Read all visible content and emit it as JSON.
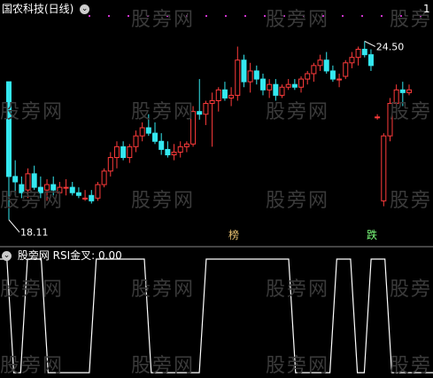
{
  "main_panel": {
    "title": "国农科技(日线)",
    "high_label": "24.50",
    "low_label": "18.11",
    "tag_left": "榜",
    "tag_right": "跌",
    "right_corner": "1"
  },
  "sub_panel": {
    "title": "股旁网 RSI金叉: 0.00"
  },
  "watermark": "股旁网",
  "colors": {
    "up": "#ff3b3b",
    "down": "#34e8f0",
    "dot": "#cc33cc",
    "tag_left": "#e8c070",
    "tag_right": "#7cff7c",
    "line": "#ffffff"
  },
  "chart_data": [
    {
      "type": "candlestick",
      "title": "国农科技(日线)",
      "ylim": [
        17.5,
        25.5
      ],
      "annotations": [
        {
          "text": "24.50",
          "note": "period high"
        },
        {
          "text": "18.11",
          "note": "period low"
        }
      ],
      "candles": [
        [
          23.2,
          23.2,
          18.1,
          19.7
        ],
        [
          19.7,
          20.3,
          19.0,
          19.5
        ],
        [
          19.4,
          19.7,
          18.9,
          19.1
        ],
        [
          19.2,
          20.0,
          18.9,
          19.8
        ],
        [
          19.8,
          20.1,
          19.2,
          19.3
        ],
        [
          19.3,
          19.7,
          18.9,
          19.1
        ],
        [
          19.2,
          19.6,
          18.8,
          19.4
        ],
        [
          19.4,
          19.7,
          19.0,
          19.2
        ],
        [
          19.1,
          19.5,
          18.9,
          19.3
        ],
        [
          19.3,
          19.6,
          19.0,
          19.3
        ],
        [
          19.3,
          19.5,
          19.0,
          19.1
        ],
        [
          19.1,
          19.3,
          18.9,
          19.0
        ],
        [
          18.9,
          19.2,
          18.8,
          18.9
        ],
        [
          19.0,
          19.2,
          18.7,
          18.8
        ],
        [
          18.9,
          19.5,
          18.8,
          19.4
        ],
        [
          19.4,
          20.0,
          19.3,
          19.9
        ],
        [
          19.9,
          20.6,
          19.7,
          20.4
        ],
        [
          20.4,
          21.0,
          20.0,
          20.8
        ],
        [
          20.8,
          21.0,
          20.3,
          20.4
        ],
        [
          20.4,
          20.9,
          20.2,
          20.8
        ],
        [
          20.8,
          21.4,
          20.6,
          21.2
        ],
        [
          21.2,
          21.7,
          21.0,
          21.5
        ],
        [
          21.5,
          22.0,
          21.2,
          21.3
        ],
        [
          21.3,
          21.7,
          20.9,
          21.0
        ],
        [
          21.0,
          21.3,
          20.5,
          20.7
        ],
        [
          20.7,
          21.0,
          20.4,
          20.5
        ],
        [
          20.5,
          20.9,
          20.3,
          20.6
        ],
        [
          20.6,
          21.0,
          20.4,
          20.8
        ],
        [
          20.8,
          21.0,
          20.6,
          20.9
        ],
        [
          20.9,
          22.3,
          20.8,
          22.1
        ],
        [
          22.1,
          23.3,
          21.8,
          22.0
        ],
        [
          22.0,
          22.5,
          21.6,
          22.4
        ],
        [
          22.4,
          22.8,
          20.8,
          22.5
        ],
        [
          22.5,
          23.0,
          22.1,
          22.9
        ],
        [
          22.9,
          23.2,
          22.5,
          22.6
        ],
        [
          22.6,
          23.0,
          22.3,
          22.7
        ],
        [
          22.7,
          24.5,
          22.5,
          24.0
        ],
        [
          24.0,
          24.2,
          23.0,
          23.2
        ],
        [
          23.2,
          23.9,
          22.8,
          23.6
        ],
        [
          23.6,
          23.8,
          23.1,
          23.3
        ],
        [
          23.3,
          23.5,
          22.7,
          22.9
        ],
        [
          22.9,
          23.3,
          22.6,
          23.1
        ],
        [
          23.1,
          23.3,
          22.5,
          22.7
        ],
        [
          22.7,
          23.1,
          22.6,
          23.0
        ],
        [
          23.0,
          23.3,
          22.9,
          23.1
        ],
        [
          23.1,
          23.3,
          22.9,
          23.0
        ],
        [
          23.0,
          23.4,
          22.8,
          23.3
        ],
        [
          23.3,
          23.6,
          23.1,
          23.5
        ],
        [
          23.5,
          23.9,
          23.2,
          23.8
        ],
        [
          23.8,
          24.2,
          23.6,
          24.0
        ],
        [
          24.0,
          24.3,
          23.5,
          23.6
        ],
        [
          23.6,
          23.8,
          23.2,
          23.3
        ],
        [
          23.3,
          23.5,
          23.0,
          23.3
        ],
        [
          23.4,
          24.0,
          23.3,
          23.9
        ],
        [
          23.9,
          24.3,
          23.7,
          24.1
        ],
        [
          24.1,
          24.5,
          23.8,
          24.4
        ],
        [
          24.4,
          24.7,
          24.1,
          24.2
        ],
        [
          24.2,
          24.4,
          23.6,
          23.8
        ],
        [
          21.9,
          22.0,
          21.8,
          21.9
        ],
        [
          18.8,
          21.3,
          18.6,
          21.2
        ],
        [
          21.2,
          22.6,
          21.0,
          22.4
        ],
        [
          22.4,
          23.1,
          22.2,
          22.9
        ],
        [
          22.9,
          23.2,
          22.3,
          22.8
        ],
        [
          22.8,
          23.1,
          22.7,
          22.9
        ]
      ]
    },
    {
      "type": "line",
      "title": "RSI金叉",
      "ylim": [
        0,
        1
      ],
      "values": [
        1,
        1,
        0,
        0,
        1,
        1,
        1,
        0,
        0,
        0,
        0,
        0,
        0,
        0,
        1,
        1,
        1,
        1,
        1,
        1,
        1,
        1,
        0,
        0,
        0,
        0,
        0,
        0,
        0,
        0,
        1,
        1,
        1,
        1,
        1,
        1,
        1,
        1,
        1,
        1,
        1,
        1,
        1,
        0,
        0,
        0,
        0,
        0,
        0,
        1,
        1,
        1,
        0,
        0,
        1,
        1,
        1,
        0,
        0,
        0,
        0,
        0,
        0,
        0
      ]
    }
  ]
}
